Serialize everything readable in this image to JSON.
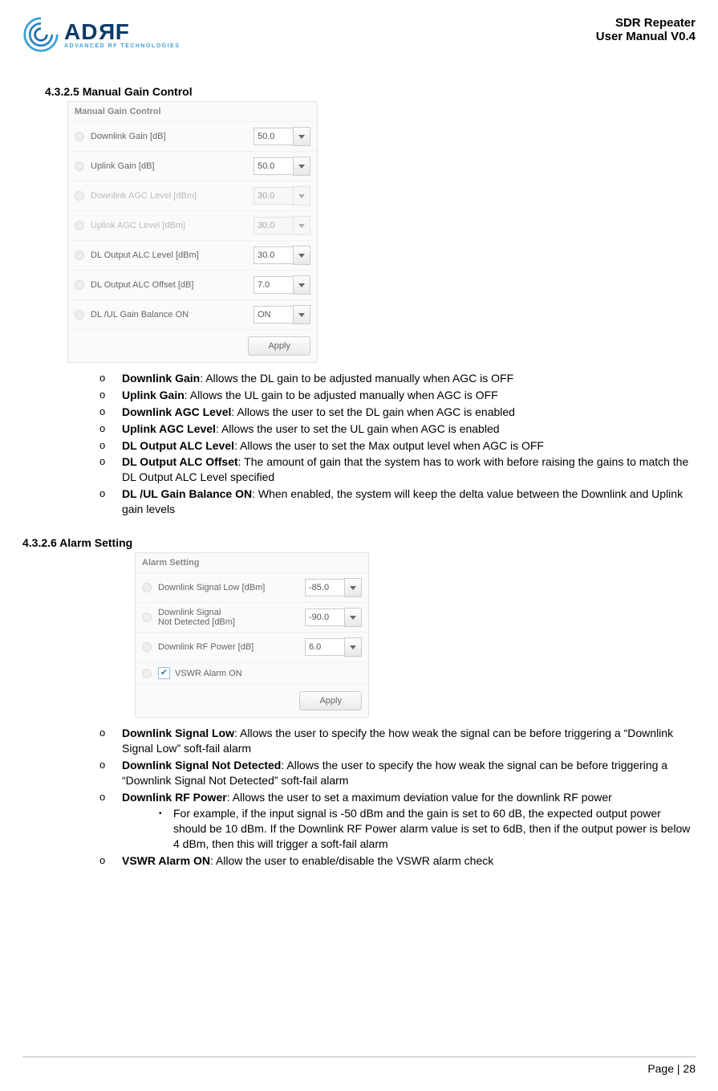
{
  "header": {
    "logo_name": "ADRF",
    "tagline": "ADVANCED RF TECHNOLOGIES",
    "title_line1": "SDR Repeater",
    "title_line2": "User Manual V0.4"
  },
  "section1": {
    "heading": "4.3.2.5 Manual Gain Control",
    "panel_title": "Manual Gain Control",
    "rows": [
      {
        "label": "Downlink Gain [dB]",
        "value": "50.0",
        "disabled": false
      },
      {
        "label": "Uplink Gain [dB]",
        "value": "50.0",
        "disabled": false
      },
      {
        "label": "Downlink AGC Level [dBm]",
        "value": "30.0",
        "disabled": true
      },
      {
        "label": "Uplink AGC Level [dBm]",
        "value": "30.0",
        "disabled": true
      },
      {
        "label": "DL Output ALC Level [dBm]",
        "value": "30.0",
        "disabled": false
      },
      {
        "label": "DL Output ALC Offset [dB]",
        "value": "7.0",
        "disabled": false
      },
      {
        "label": "DL /UL Gain Balance ON",
        "value": "ON",
        "disabled": false
      }
    ],
    "apply": "Apply",
    "bullets": [
      {
        "term": "Downlink Gain",
        "desc": ": Allows the DL gain to be adjusted manually when AGC is OFF"
      },
      {
        "term": "Uplink Gain",
        "desc": ": Allows the UL gain to be adjusted manually when AGC is OFF"
      },
      {
        "term": "Downlink AGC Level",
        "desc": ": Allows the user to set the DL gain when AGC is enabled"
      },
      {
        "term": "Uplink AGC Level",
        "desc": ": Allows the user to set the UL gain when AGC is enabled"
      },
      {
        "term": "DL Output ALC Level",
        "desc": ": Allows the user to set the Max output level when AGC is OFF"
      },
      {
        "term": "DL Output ALC Offset",
        "desc": ": The amount of gain that the system has to work with before raising the gains to match the DL Output ALC Level specified"
      },
      {
        "term": "DL /UL Gain Balance ON",
        "desc": ": When enabled, the system will keep the delta value between the Downlink and Uplink gain levels"
      }
    ]
  },
  "section2": {
    "heading": "4.3.2.6 Alarm Setting",
    "panel_title": "Alarm Setting",
    "rows": [
      {
        "label": "Downlink Signal Low [dBm]",
        "value": "-85.0"
      },
      {
        "label_line1": "Downlink Signal",
        "label_line2": "Not Detected [dBm]",
        "value": "-90.0"
      },
      {
        "label": "Downlink RF Power [dB]",
        "value": "6.0"
      }
    ],
    "vswr_label": "VSWR Alarm ON",
    "apply": "Apply",
    "bullets": [
      {
        "term": "Downlink Signal Low",
        "desc": ": Allows the user to specify the how weak the signal can be before triggering a “Downlink Signal Low” soft-fail alarm"
      },
      {
        "term": "Downlink Signal Not Detected",
        "desc": ": Allows the user to specify the how weak the signal can be before triggering a “Downlink Signal Not Detected” soft-fail alarm"
      },
      {
        "term": "Downlink RF Power",
        "desc": ": Allows the user to set a maximum deviation value for the downlink RF power",
        "sub": "For example, if the input signal is -50 dBm and the gain is set to 60 dB, the expected output power should be 10 dBm.  If the Downlink RF Power alarm value is set to 6dB, then if the output power is below 4 dBm, then this will trigger a soft-fail alarm"
      },
      {
        "term": "VSWR Alarm ON",
        "desc": ": Allow the user to enable/disable the VSWR alarm check"
      }
    ]
  },
  "footer": {
    "page_label": "Page | 28"
  }
}
